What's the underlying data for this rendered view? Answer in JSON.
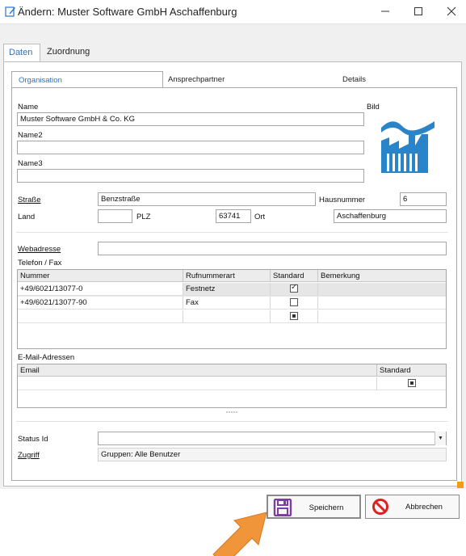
{
  "window": {
    "title": "Ändern: Muster Software GmbH Aschaffenburg"
  },
  "outer_tabs": [
    "Daten",
    "Zuordnung"
  ],
  "inner_tabs": [
    "Organisation",
    "Ansprechpartner",
    "Details"
  ],
  "form": {
    "name_label": "Name",
    "name_value": "Muster Software GmbH & Co. KG",
    "name2_label": "Name2",
    "name3_label": "Name3",
    "bild_label": "Bild",
    "strasse_label": "Straße",
    "strasse_value": "Benzstraße",
    "hausnummer_label": "Hausnummer",
    "hausnummer_value": "6",
    "land_label": "Land",
    "plz_label": "PLZ",
    "plz_value": "63741",
    "ort_label": "Ort",
    "ort_value": "Aschaffenburg",
    "webadresse_label": "Webadresse",
    "telefon_label": "Telefon / Fax",
    "email_label": "E-Mail-Adressen",
    "status_label": "Status Id",
    "zugriff_label": "Zugriff",
    "zugriff_value": "Gruppen: Alle Benutzer"
  },
  "phone_table": {
    "columns": [
      "Nummer",
      "Rufnummerart",
      "Standard",
      "Bemerkung"
    ],
    "rows": [
      {
        "nummer": "+49/6021/13077-0",
        "art": "Festnetz",
        "standard": "checked"
      },
      {
        "nummer": "+49/6021/13077-90",
        "art": "Fax",
        "standard": "unchecked"
      },
      {
        "nummer": "",
        "art": "",
        "standard": "indeterminate"
      }
    ]
  },
  "email_table": {
    "columns": [
      "Email",
      "Standard"
    ]
  },
  "buttons": {
    "save": "Speichern",
    "cancel": "Abbrechen"
  },
  "colors": {
    "accent": "#2a73c7",
    "logo": "#2a84c9",
    "arrow": "#f0953a",
    "cancel_red": "#e02020",
    "save_purple": "#7a3fa0",
    "resize_orange": "#f39c12"
  }
}
